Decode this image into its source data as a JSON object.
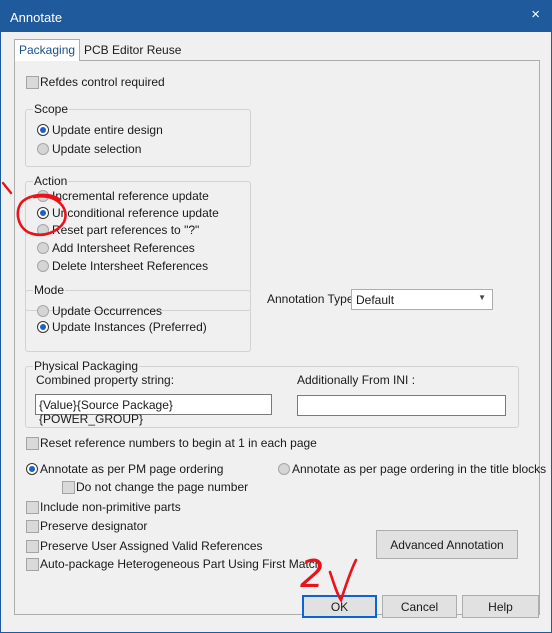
{
  "window": {
    "title": "Annotate",
    "close_glyph": "×"
  },
  "tabs": [
    {
      "label": "Packaging"
    },
    {
      "label": "PCB Editor Reuse"
    }
  ],
  "refdes_control": {
    "label": "Refdes control required"
  },
  "scope": {
    "label": "Scope",
    "options": [
      {
        "label": "Update entire design"
      },
      {
        "label": "Update selection"
      }
    ]
  },
  "action": {
    "label": "Action",
    "options": [
      {
        "label": "Incremental reference update"
      },
      {
        "label": "Unconditional reference update"
      },
      {
        "label": "Reset part references to \"?\""
      },
      {
        "label": "Add Intersheet References"
      },
      {
        "label": "Delete Intersheet References"
      }
    ]
  },
  "mode": {
    "label": "Mode",
    "options": [
      {
        "label": "Update Occurrences"
      },
      {
        "label": "Update Instances (Preferred)"
      }
    ]
  },
  "annotation_type": {
    "label": "Annotation Type",
    "value": "Default"
  },
  "physical_packaging": {
    "label": "Physical Packaging",
    "combined_label": "Combined property string:",
    "combined_value": "{Value}{Source Package}{POWER_GROUP}",
    "ini_label": "Additionally From INI :",
    "ini_value": ""
  },
  "checks": {
    "reset_numbers": "Reset reference numbers to begin at 1 in each page",
    "annotate_pm": "Annotate as per PM page ordering",
    "annotate_title": "Annotate as per page ordering in the title blocks",
    "no_change_page": "Do not change the page number",
    "non_primitive": "Include non-primitive parts",
    "preserve_designator": "Preserve designator",
    "preserve_user": "Preserve User Assigned Valid References",
    "auto_package": "Auto-package Heterogeneous Part Using First Match"
  },
  "buttons": {
    "advanced": "Advanced Annotation",
    "ok": "OK",
    "cancel": "Cancel",
    "help": "Help"
  },
  "annotations": {
    "ink_color": "#e8131b",
    "ink_text": "2"
  }
}
